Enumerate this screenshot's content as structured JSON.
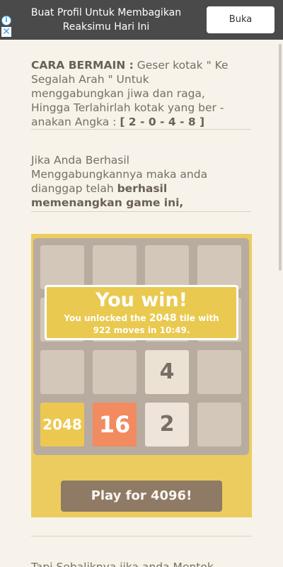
{
  "ad": {
    "info_icon": "info-icon",
    "close_icon": "close-icon",
    "text": "Buat Profil Untuk Membagikan Reaksimu Hari Ini",
    "button_label": "Buka"
  },
  "article": {
    "p1_bold": "CARA BERMAIN :",
    "p1_text": " Geser kotak \" Ke Segalah Arah \" Untuk menggabungkan jiwa dan raga, Hingga Terlahirlah kotak yang ber - anakan Angka : ",
    "p1_bold_end": "[ 2 - 0 - 4 - 8 ]",
    "p2_text": "Jika Anda Berhasil Menggabungkannya maka anda dianggap telah ",
    "p2_bold": "berhasil memenangkan game ini,",
    "p3_text": "Tapi Sebaliknya jika anda Mentok Sampek"
  },
  "game": {
    "tiles": [
      [
        "",
        "",
        "",
        ""
      ],
      [
        "",
        "",
        "",
        ""
      ],
      [
        "",
        "",
        "4",
        ""
      ],
      [
        "2048",
        "16",
        "2",
        ""
      ]
    ],
    "win_title": "You win!",
    "win_line1_pre": "You unlocked the ",
    "win_line1_num": "2048",
    "win_line1_post": " tile with",
    "win_line2": "922 moves in 10:49.",
    "play_button": "Play for 4096!"
  }
}
